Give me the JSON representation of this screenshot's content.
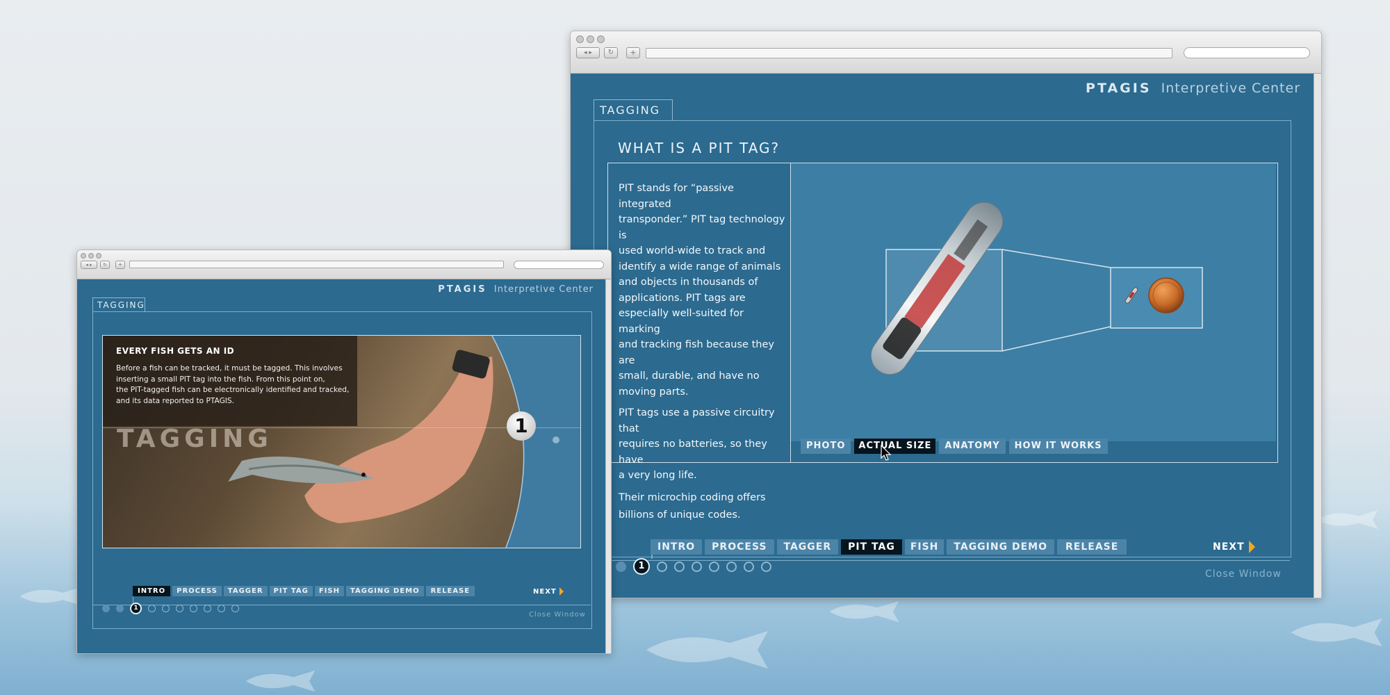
{
  "small_window": {
    "brand": {
      "name": "PTAGIS",
      "suffix": "Interpretive Center"
    },
    "section_tab": "TAGGING",
    "caption_title": "EVERY FISH GETS AN ID",
    "caption_lines": [
      "Before a fish can be tracked, it must be tagged. This involves",
      "inserting a small PIT tag into the fish. From this point on,",
      "the PIT-tagged fish can be electronically identified and tracked,",
      "and its data reported to PTAGIS."
    ],
    "hero_label": "TAGGING",
    "step_badge": "1",
    "nav": [
      "INTRO",
      "PROCESS",
      "TAGGER",
      "PIT TAG",
      "FISH",
      "TAGGING DEMO",
      "RELEASE"
    ],
    "active_nav": "INTRO",
    "next_label": "NEXT",
    "current_step": "1",
    "close_label": "Close Window"
  },
  "large_window": {
    "brand": {
      "name": "PTAGIS",
      "suffix": "Interpretive Center"
    },
    "section_tab": "TAGGING",
    "heading": "WHAT IS A PIT TAG?",
    "body_lines_1": [
      "PIT stands for “passive integrated",
      "transponder.” PIT tag technology is",
      "used world-wide to track and",
      "identify a wide range of animals",
      "and objects in thousands of",
      "applications. PIT tags are",
      "especially well-suited for marking",
      "and tracking fish because they are",
      "small, durable, and have no",
      "moving parts."
    ],
    "body_lines_2": [
      "PIT tags use a passive circuitry that",
      "requires no batteries, so they have",
      "a very long life."
    ],
    "body_lines_3": [
      "Their microchip coding offers",
      "billions of unique codes."
    ],
    "view_tabs": [
      "PHOTO",
      "ACTUAL SIZE",
      "ANATOMY",
      "HOW IT WORKS"
    ],
    "active_view_tab": "ACTUAL SIZE",
    "nav": [
      "INTRO",
      "PROCESS",
      "TAGGER",
      "PIT TAG",
      "FISH",
      "TAGGING DEMO",
      "RELEASE"
    ],
    "active_nav": "PIT TAG",
    "next_label": "NEXT",
    "current_step": "1",
    "close_label": "Close Window"
  },
  "colors": {
    "page_bg": "#2c6a8f",
    "nav_item": "#4c84a8",
    "nav_active": "#06141d",
    "next_arrow": "#f5a623"
  },
  "icons": [
    "back-forward-icon",
    "reload-icon",
    "add-tab-icon",
    "next-arrow-icon",
    "cursor-icon"
  ]
}
